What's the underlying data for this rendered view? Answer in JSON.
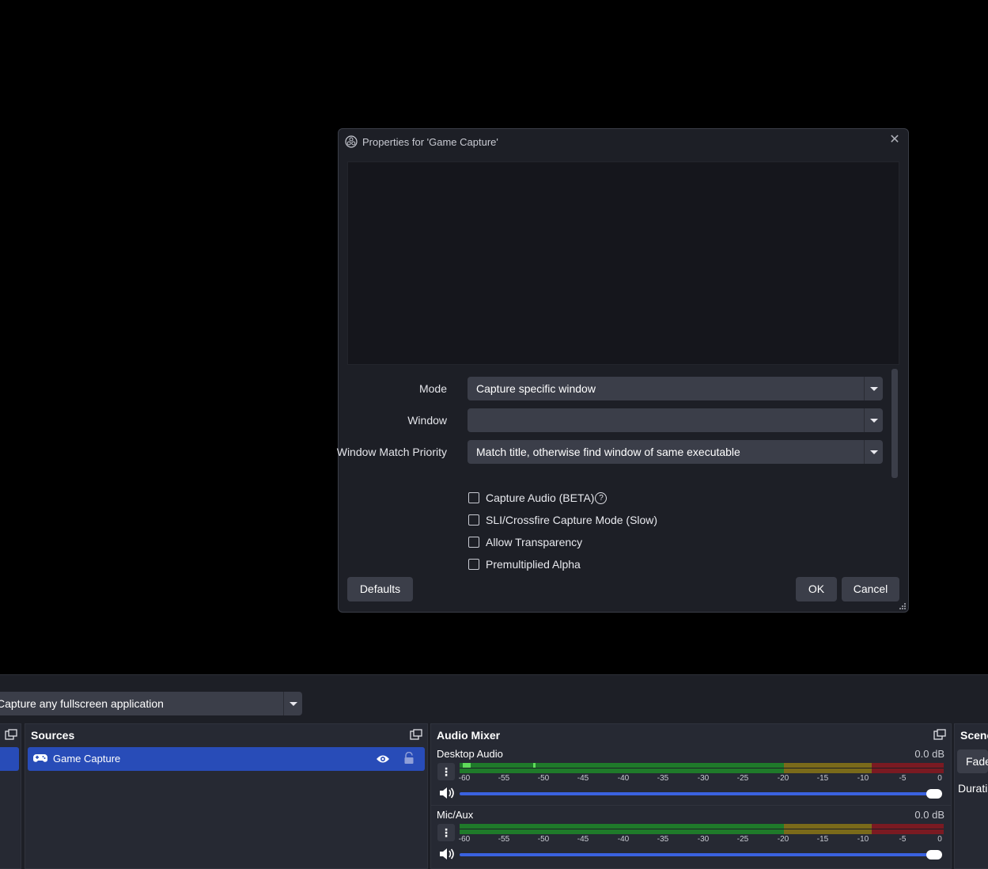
{
  "dialog": {
    "title": "Properties for 'Game Capture'",
    "mode_label": "Mode",
    "mode_value": "Capture specific window",
    "window_label": "Window",
    "window_value": "",
    "priority_label": "Window Match Priority",
    "priority_value": "Match title, otherwise find window of same executable",
    "checkboxes": [
      {
        "label": "Capture Audio (BETA)",
        "checked": false
      },
      {
        "label": "SLI/Crossfire Capture Mode (Slow)",
        "checked": false
      },
      {
        "label": "Allow Transparency",
        "checked": false
      },
      {
        "label": "Premultiplied Alpha",
        "checked": false
      }
    ],
    "defaults_label": "Defaults",
    "ok_label": "OK",
    "cancel_label": "Cancel",
    "help_symbol": "?"
  },
  "source_select": {
    "value": "Capture any fullscreen application"
  },
  "sources": {
    "title": "Sources",
    "items": [
      {
        "name": "Game Capture"
      }
    ]
  },
  "audio_mixer": {
    "title": "Audio Mixer",
    "ticks": [
      "-60",
      "-55",
      "-50",
      "-45",
      "-40",
      "-35",
      "-30",
      "-25",
      "-20",
      "-15",
      "-10",
      "-5",
      "0"
    ],
    "channels": [
      {
        "name": "Desktop Audio",
        "db": "0.0 dB",
        "volume": 1.0
      },
      {
        "name": "Mic/Aux",
        "db": "0.0 dB",
        "volume": 1.0
      }
    ]
  },
  "scene_transitions": {
    "title": "Scene",
    "transition": "Fade",
    "duration_label": "Durati"
  },
  "colors": {
    "accent": "#284cb8",
    "meter_green": "#1f7a2a",
    "meter_yellow": "#7a6a1a",
    "meter_red": "#7a1a22",
    "slider": "#3a62e0"
  }
}
